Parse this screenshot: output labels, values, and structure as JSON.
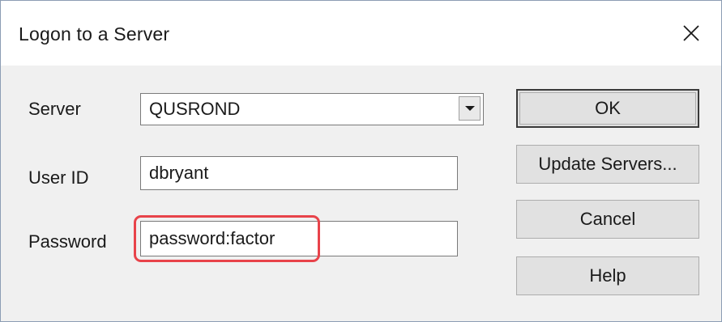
{
  "dialog": {
    "title": "Logon to a Server"
  },
  "form": {
    "server": {
      "label": "Server",
      "value": "QUSROND"
    },
    "user_id": {
      "label": "User ID",
      "value": "dbryant"
    },
    "password": {
      "label": "Password",
      "value": "password:factor"
    }
  },
  "buttons": {
    "ok": "OK",
    "update_servers": "Update Servers...",
    "cancel": "Cancel",
    "help": "Help"
  },
  "icons": {
    "close": "close-icon",
    "dropdown": "chevron-down-icon"
  },
  "colors": {
    "highlight": "#e8434a",
    "dialog_bg": "#f0f0f0"
  }
}
